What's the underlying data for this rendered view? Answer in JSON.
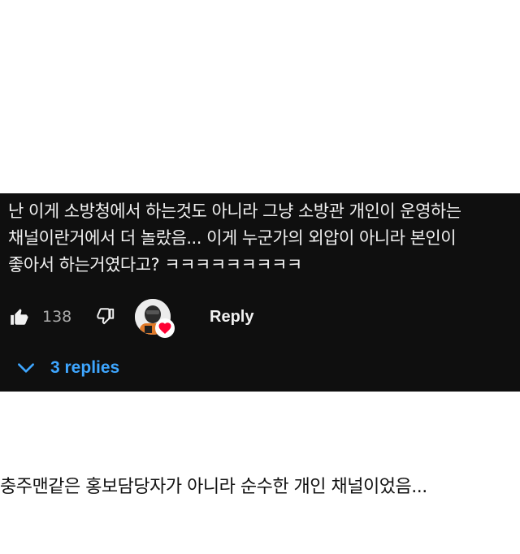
{
  "comment": {
    "lines": [
      "난 이게 소방청에서 하는것도 아니라 그냥 소방관 개인이 운영하는",
      "채널이란거에서 더 놀랐음... 이게 누군가의 외압이 아니라 본인이",
      "좋아서 하는거였다고? ㅋㅋㅋㅋㅋㅋㅋㅋㅋ"
    ],
    "like_count": "138",
    "reply_label": "Reply",
    "replies_label": "3 replies"
  },
  "icons": {
    "like": "thumb-up-icon",
    "dislike": "thumb-down-icon",
    "creator_avatar": "creator-avatar",
    "heart": "heart-icon",
    "chevron": "chevron-down-icon"
  },
  "colors": {
    "card_background": "#0f0f0f",
    "text": "#f1f1f1",
    "muted_text": "#aaaaaa",
    "link_blue": "#3ea6ff",
    "heart_red": "#ff0033"
  },
  "caption": "충주맨같은 홍보담당자가 아니라 순수한 개인 채널이었음..."
}
